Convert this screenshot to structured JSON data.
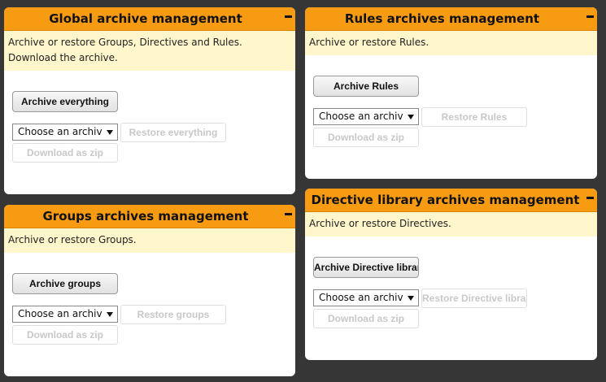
{
  "panels": {
    "global": {
      "title": "Global archive management",
      "description": "Archive or restore Groups, Directives and Rules. Download the archive.",
      "archive_label": "Archive everything",
      "select_value": "Choose an archive",
      "restore_label": "Restore everything",
      "download_label": "Download as zip"
    },
    "rules": {
      "title": "Rules archives management",
      "description": "Archive or restore Rules.",
      "archive_label": "Archive Rules",
      "select_value": "Choose an archive",
      "restore_label": "Restore Rules",
      "download_label": "Download as zip"
    },
    "groups": {
      "title": "Groups archives management",
      "description": "Archive or restore Groups.",
      "archive_label": "Archive groups",
      "select_value": "Choose an archive",
      "restore_label": "Restore groups",
      "download_label": "Download as zip"
    },
    "directives": {
      "title": "Directive library archives management",
      "description": "Archive or restore Directives.",
      "archive_label": "Archive Directive library",
      "select_value": "Choose an archive",
      "restore_label": "Restore Directive library",
      "download_label": "Download as zip"
    }
  },
  "icons": {
    "collapse": "minus-icon",
    "select_arrow": "triangle-down-icon"
  },
  "colors": {
    "header": "#f69b12",
    "description_bg": "#fff6cc",
    "background": "#363636"
  }
}
